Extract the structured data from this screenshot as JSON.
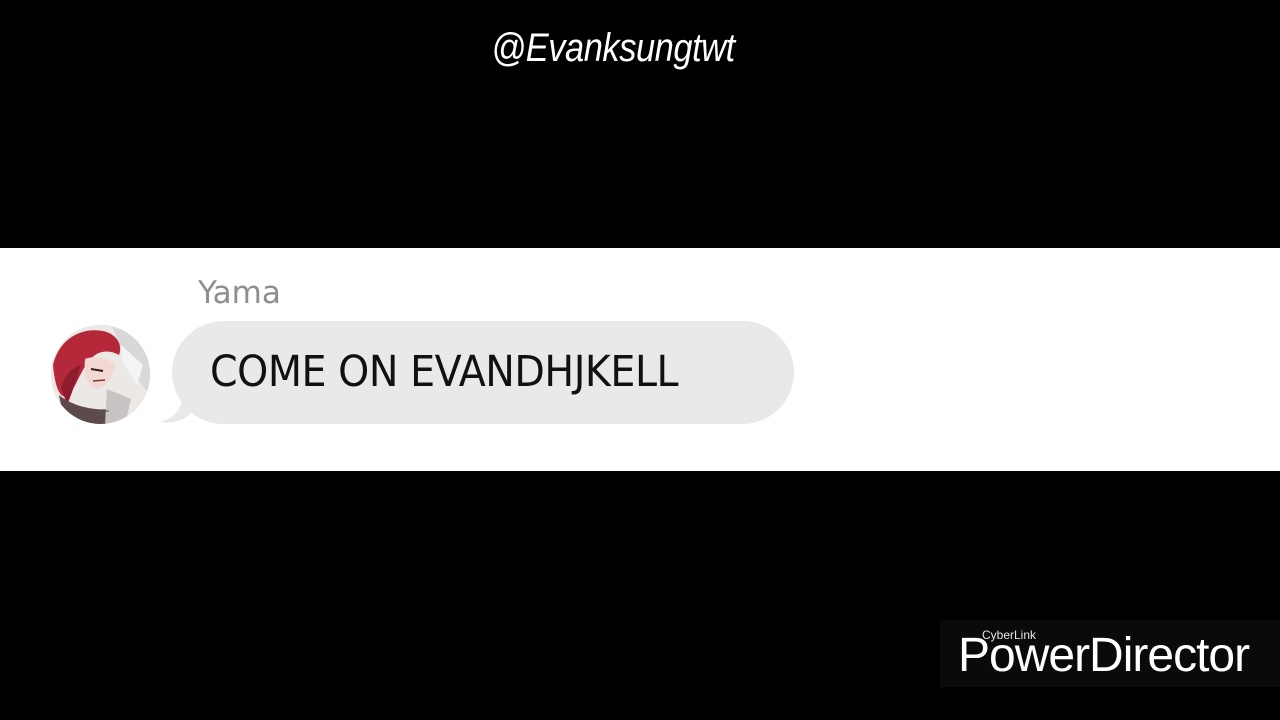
{
  "header": {
    "handle": "@Evanksungtwt"
  },
  "message": {
    "sender_name": "Yama",
    "text": "COME ON EVANDHJKELL",
    "avatar_icon": "red-haired-character-avatar-icon"
  },
  "watermark": {
    "brand_small": "CyberLink",
    "brand_large": "PowerDirector"
  },
  "colors": {
    "background": "#000000",
    "chat_strip": "#ffffff",
    "bubble": "#e9e9eb",
    "sender_name": "#8e8e93",
    "message_text": "#111111"
  }
}
